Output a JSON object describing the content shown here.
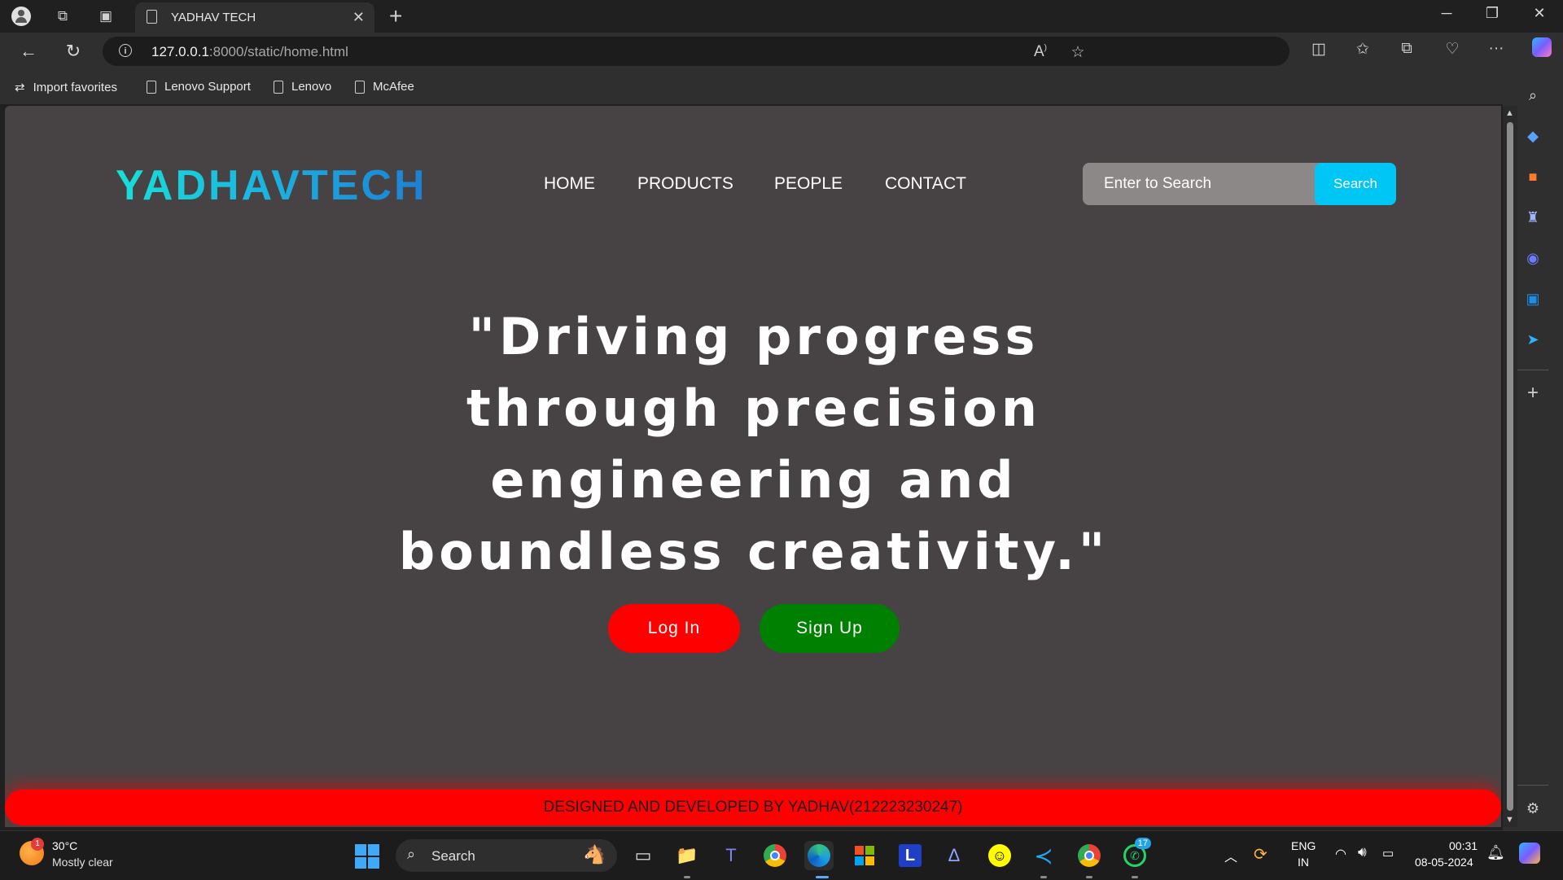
{
  "browser": {
    "tab_title": "YADHAV TECH",
    "url_main": "127.0.0.1",
    "url_rest": ":8000/static/home.html",
    "favorites": [
      "Import favorites",
      "Lenovo Support",
      "Lenovo",
      "McAfee"
    ]
  },
  "page": {
    "logo": "YADHAVTECH",
    "nav": [
      "HOME",
      "PRODUCTS",
      "PEOPLE",
      "CONTACT"
    ],
    "search_placeholder": "Enter to Search",
    "search_button": "Search",
    "hero_quote": "\"Driving progress\nthrough precision\nengineering and\nboundless creativity.\"",
    "login_label": "Log In",
    "signup_label": "Sign Up",
    "footer_text": "DESIGNED AND DEVELOPED BY YADHAV(212223230247)",
    "colors": {
      "background": "#474344",
      "accent": "#00c6f5",
      "login": "#ff0000",
      "signup": "#008000",
      "footer": "#ff0000"
    }
  },
  "taskbar": {
    "weather_temp": "30°C",
    "weather_condition": "Mostly clear",
    "weather_badge": "1",
    "search_label": "Search",
    "language": "ENG",
    "region": "IN",
    "time": "00:31",
    "date": "08-05-2024",
    "whatsapp_badge": "17"
  }
}
